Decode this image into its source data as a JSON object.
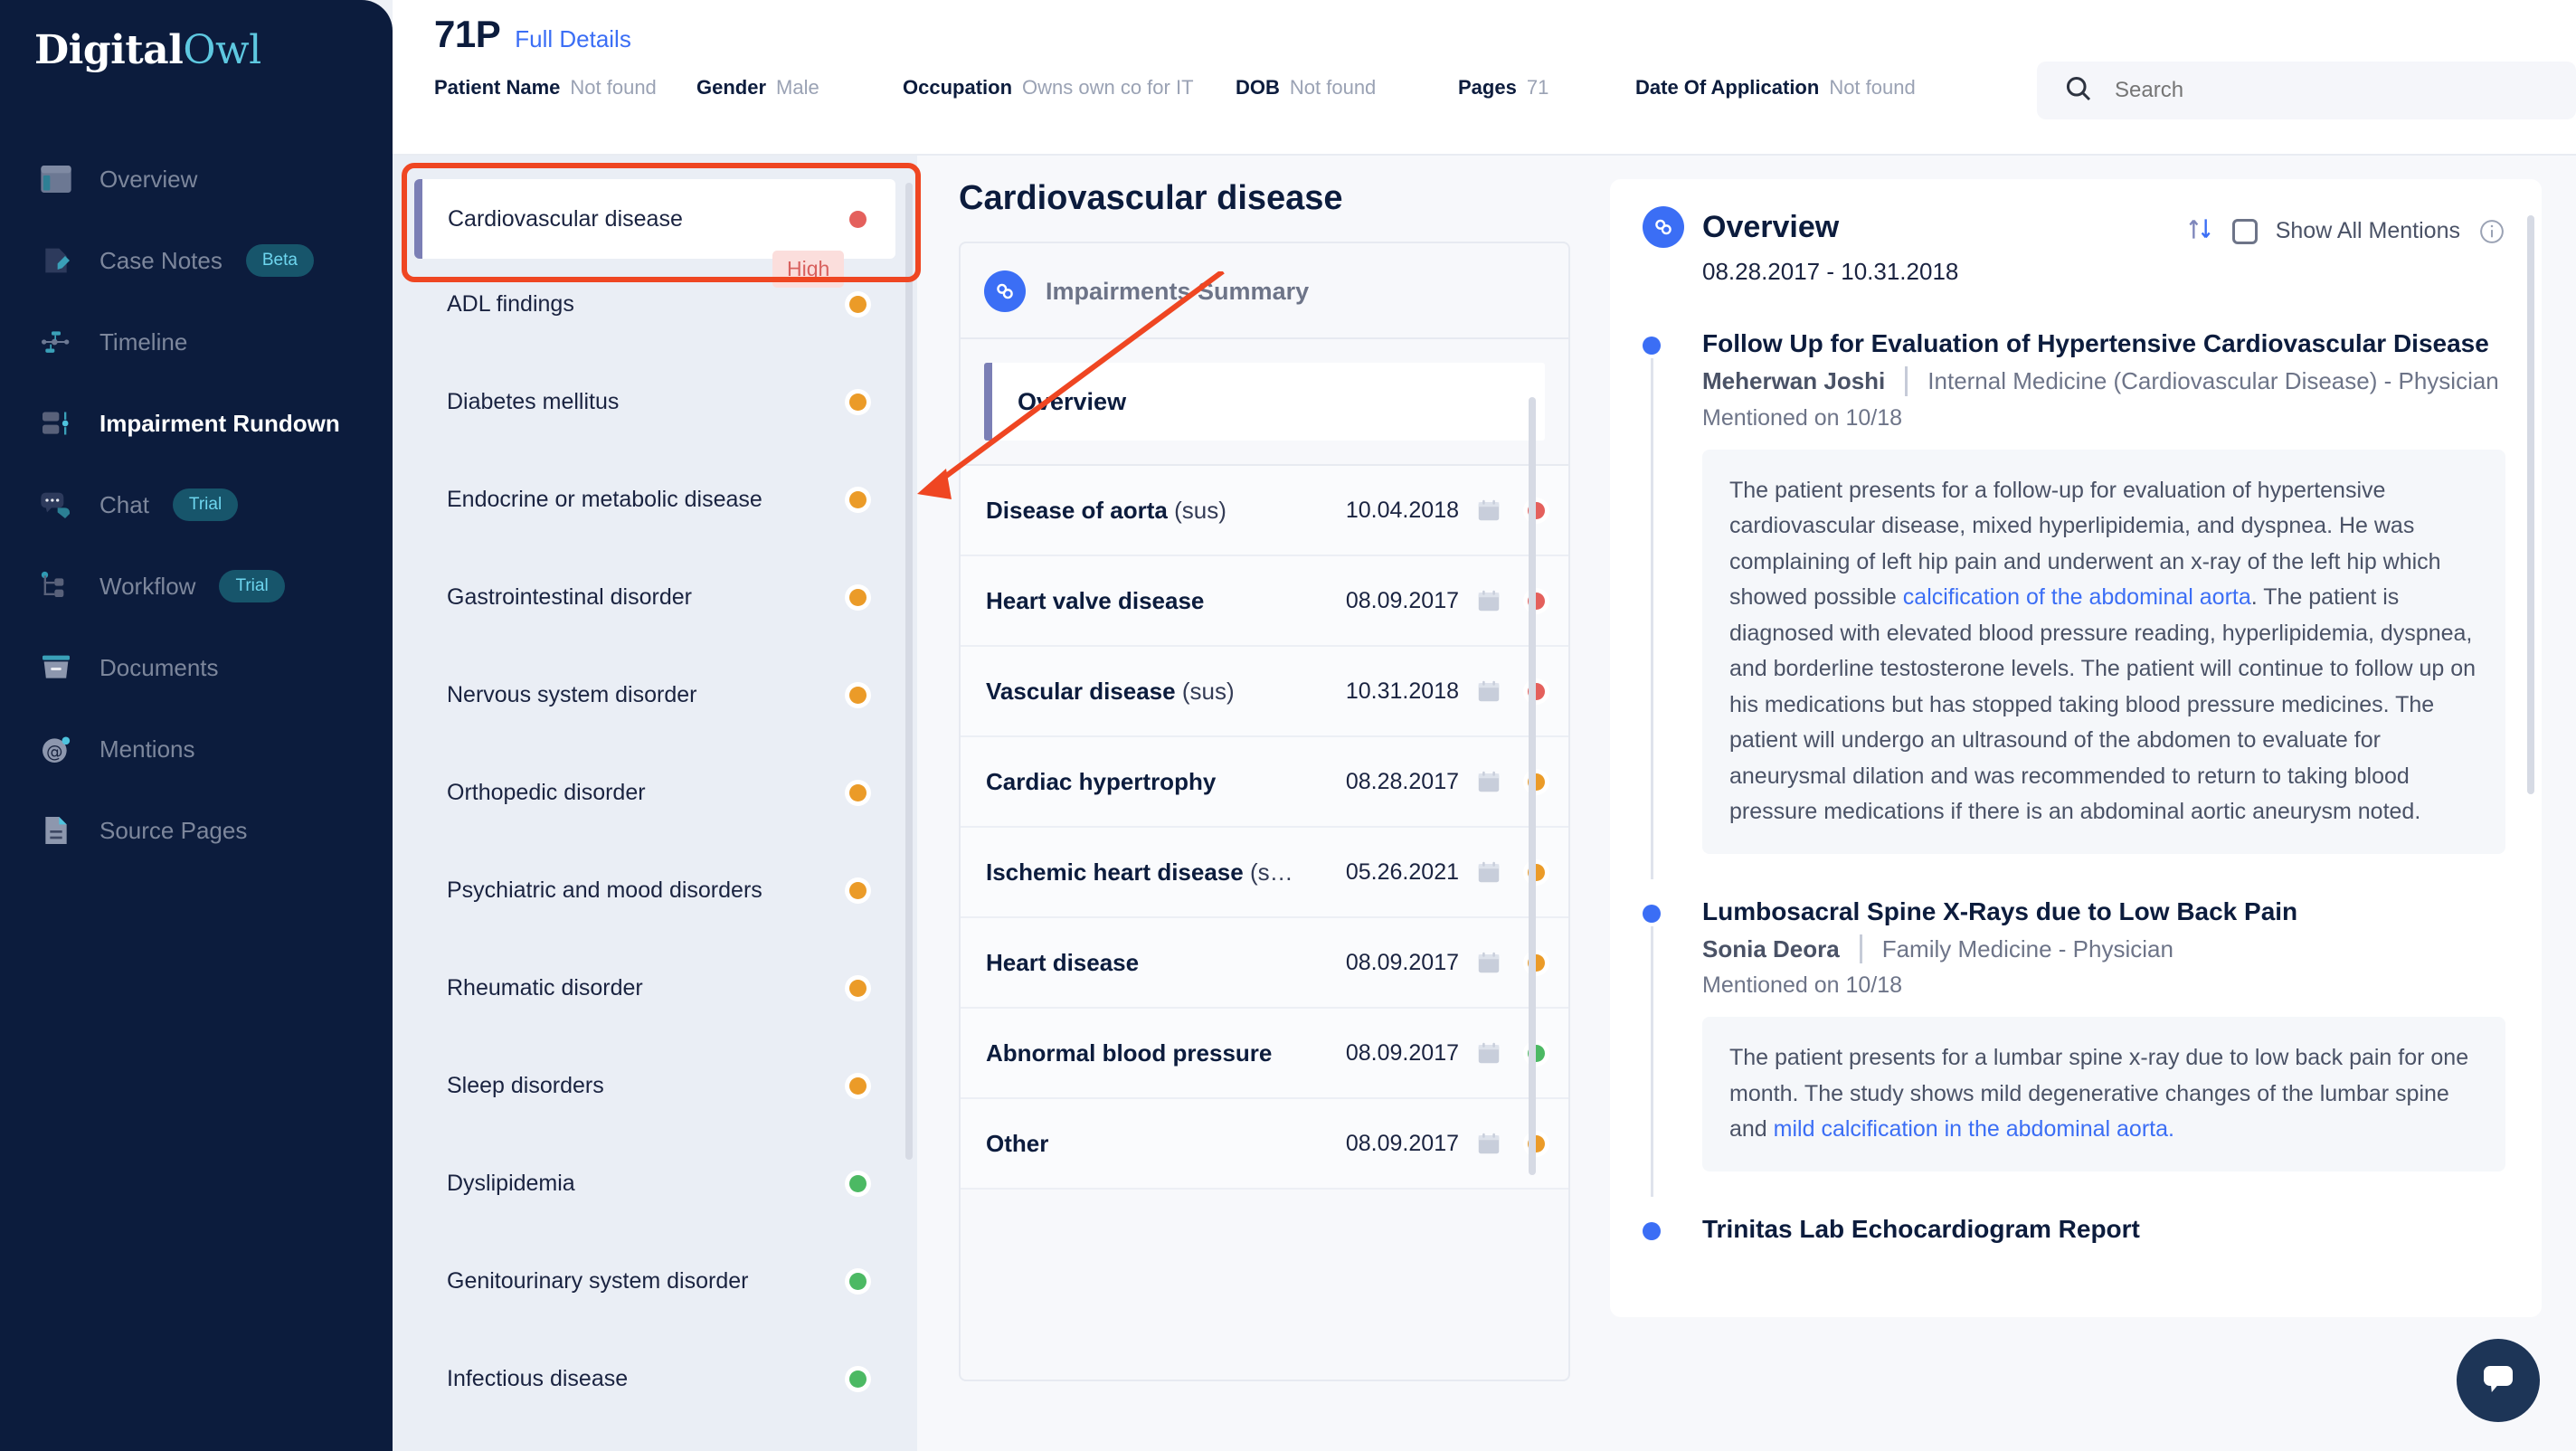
{
  "brand": {
    "part1": "Digital",
    "part2": "Owl"
  },
  "sidebar": {
    "items": [
      {
        "label": "Overview",
        "icon": "layout-icon",
        "badge": null,
        "active": false
      },
      {
        "label": "Case Notes",
        "icon": "note-edit-icon",
        "badge": "Beta",
        "active": false
      },
      {
        "label": "Timeline",
        "icon": "timeline-icon",
        "badge": null,
        "active": false
      },
      {
        "label": "Impairment Rundown",
        "icon": "rundown-icon",
        "badge": null,
        "active": true
      },
      {
        "label": "Chat",
        "icon": "chat-icon",
        "badge": "Trial",
        "active": false
      },
      {
        "label": "Workflow",
        "icon": "workflow-icon",
        "badge": "Trial",
        "active": false
      },
      {
        "label": "Documents",
        "icon": "documents-icon",
        "badge": null,
        "active": false
      },
      {
        "label": "Mentions",
        "icon": "mentions-icon",
        "badge": null,
        "active": false
      },
      {
        "label": "Source Pages",
        "icon": "source-pages-icon",
        "badge": null,
        "active": false
      }
    ]
  },
  "header": {
    "case_id": "71P",
    "full_details_link": "Full Details",
    "meta": [
      {
        "key": "Patient Name",
        "value": "Not found"
      },
      {
        "key": "Gender",
        "value": "Male"
      },
      {
        "key": "Occupation",
        "value": "Owns own co for IT"
      },
      {
        "key": "DOB",
        "value": "Not found"
      },
      {
        "key": "Pages",
        "value": "71"
      },
      {
        "key": "Date Of Application",
        "value": "Not found"
      }
    ],
    "search": {
      "placeholder": "Search",
      "value": ""
    }
  },
  "impairment_list": {
    "selected_badge": "High",
    "items": [
      {
        "label": "Cardiovascular disease",
        "severity": "red",
        "selected": true
      },
      {
        "label": "ADL findings",
        "severity": "orange",
        "selected": false
      },
      {
        "label": "Diabetes mellitus",
        "severity": "orange",
        "selected": false
      },
      {
        "label": "Endocrine or metabolic disease",
        "severity": "orange",
        "selected": false
      },
      {
        "label": "Gastrointestinal disorder",
        "severity": "orange",
        "selected": false
      },
      {
        "label": "Nervous system disorder",
        "severity": "orange",
        "selected": false
      },
      {
        "label": "Orthopedic disorder",
        "severity": "orange",
        "selected": false
      },
      {
        "label": "Psychiatric and mood disorders",
        "severity": "orange",
        "selected": false
      },
      {
        "label": "Rheumatic disorder",
        "severity": "orange",
        "selected": false
      },
      {
        "label": "Sleep disorders",
        "severity": "orange",
        "selected": false
      },
      {
        "label": "Dyslipidemia",
        "severity": "green",
        "selected": false
      },
      {
        "label": "Genitourinary system disorder",
        "severity": "green",
        "selected": false
      },
      {
        "label": "Infectious disease",
        "severity": "green",
        "selected": false
      }
    ]
  },
  "summary": {
    "page_title": "Cardiovascular disease",
    "card_header": "Impairments Summary",
    "overview_row": "Overview",
    "items": [
      {
        "name": "Disease of aorta",
        "suffix": "(sus)",
        "date": "10.04.2018",
        "severity": "red"
      },
      {
        "name": "Heart valve disease",
        "suffix": "",
        "date": "08.09.2017",
        "severity": "red"
      },
      {
        "name": "Vascular disease",
        "suffix": "(sus)",
        "date": "10.31.2018",
        "severity": "red"
      },
      {
        "name": "Cardiac hypertrophy",
        "suffix": "",
        "date": "08.28.2017",
        "severity": "orange"
      },
      {
        "name": "Ischemic heart disease",
        "suffix": "(s…",
        "date": "05.26.2021",
        "severity": "orange"
      },
      {
        "name": "Heart disease",
        "suffix": "",
        "date": "08.09.2017",
        "severity": "orange"
      },
      {
        "name": "Abnormal blood pressure",
        "suffix": "",
        "date": "08.09.2017",
        "severity": "green"
      },
      {
        "name": "Other",
        "suffix": "",
        "date": "08.09.2017",
        "severity": "orange"
      }
    ]
  },
  "detail": {
    "title": "Overview",
    "date_range": "08.28.2017 - 10.31.2018",
    "show_all_mentions": "Show All Mentions",
    "entries": [
      {
        "title": "Follow Up for Evaluation of Hypertensive Cardiovascular Disease",
        "doctor": "Meherwan Joshi",
        "specialty": "Internal Medicine (Cardiovascular Disease) - Physician",
        "mentioned": "Mentioned on 10/18",
        "quote_pre": "The patient presents for a follow-up for evaluation of hypertensive cardiovascular disease, mixed hyperlipidemia, and dyspnea. He was complaining of left hip pain and underwent an x-ray of the left hip which showed possible ",
        "quote_link": "calcification of the abdominal aorta",
        "quote_post": ". The patient is diagnosed with elevated blood pressure reading, hyperlipidemia, dyspnea, and borderline testosterone levels. The patient will continue to follow up on his medications but has stopped taking blood pressure medicines. The patient will undergo an ultrasound of the abdomen to evaluate for aneurysmal dilation and was recommended to return to taking blood pressure medications if there is an abdominal aortic aneurysm noted."
      },
      {
        "title": "Lumbosacral Spine X-Rays due to Low Back Pain",
        "doctor": "Sonia Deora",
        "specialty": "Family Medicine - Physician",
        "mentioned": "Mentioned on 10/18",
        "quote_pre": "The patient presents for a lumbar spine x-ray due to low back pain for one month. The study shows mild degenerative changes of the lumbar spine and ",
        "quote_link": "mild calcification in the abdominal aorta.",
        "quote_post": ""
      },
      {
        "title": "Trinitas Lab Echocardiogram Report",
        "doctor": "",
        "specialty": "",
        "mentioned": "",
        "quote_pre": "",
        "quote_link": "",
        "quote_post": ""
      }
    ]
  },
  "colors": {
    "sidebar_bg": "#0c1c3d",
    "accent_blue": "#3b6ef5",
    "brand_cyan": "#5ec8e0",
    "severity_high": "#e4605c",
    "severity_medium": "#eb9b28",
    "severity_low": "#4cb963",
    "annotation": "#ef4622"
  }
}
